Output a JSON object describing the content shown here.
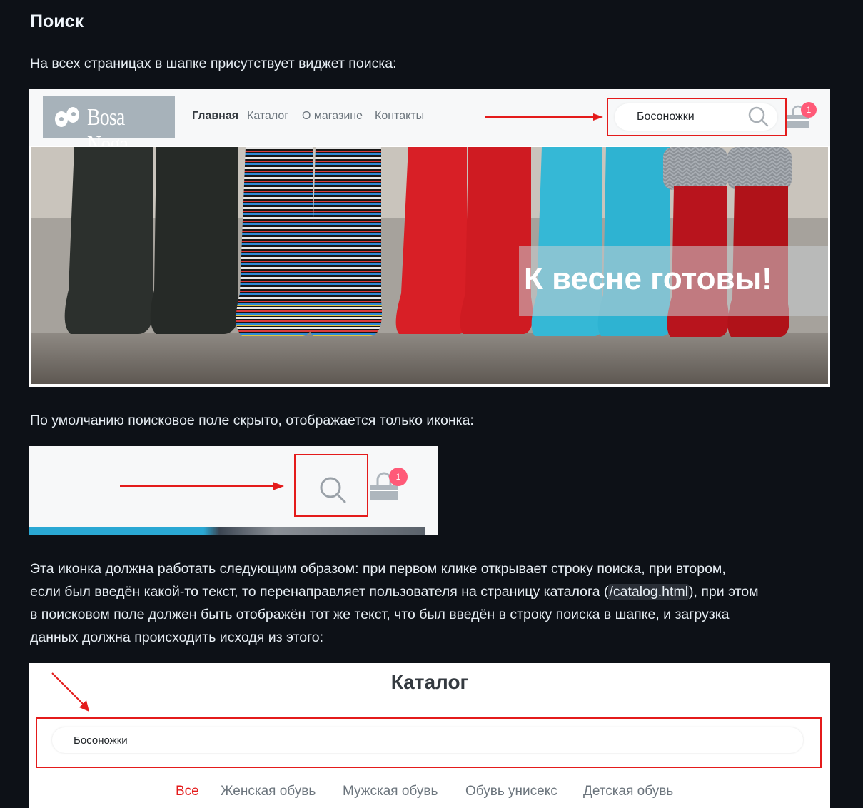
{
  "heading": "Поиск",
  "intro": "На всех страницах в шапке присутствует виджет поиска:",
  "screenshot1": {
    "logo_text": "Bosa Noga",
    "nav": [
      "Главная",
      "Каталог",
      "О магазине",
      "Контакты"
    ],
    "search_value": "Босоножки",
    "cart_count": "1",
    "banner_text": "К весне готовы!"
  },
  "para2": "По умолчанию поисковое поле скрыто, отображается только иконка:",
  "screenshot2": {
    "cart_count": "1"
  },
  "para3": {
    "a": "Эта иконка должна работать следующим образом: при первом клике открывает строку поиска, при втором,",
    "b1": "если был введён какой-то текст, то перенаправляет пользователя на страницу каталога (",
    "b_code": "/catalog.html",
    "b2": "), при этом",
    "c": "в поисковом поле должен быть отображён тот же текст, что был введён в строку поиска в шапке, и загрузка",
    "d": "данных должна происходить исходя из этого:"
  },
  "screenshot3": {
    "title": "Каталог",
    "search_value": "Босоножки",
    "categories": [
      "Все",
      "Женская обувь",
      "Мужская обувь",
      "Обувь унисекс",
      "Детская обувь"
    ]
  },
  "colors": {
    "background": "#0d1117",
    "highlight_red": "#e41b1b",
    "badge": "#ff5a78"
  }
}
